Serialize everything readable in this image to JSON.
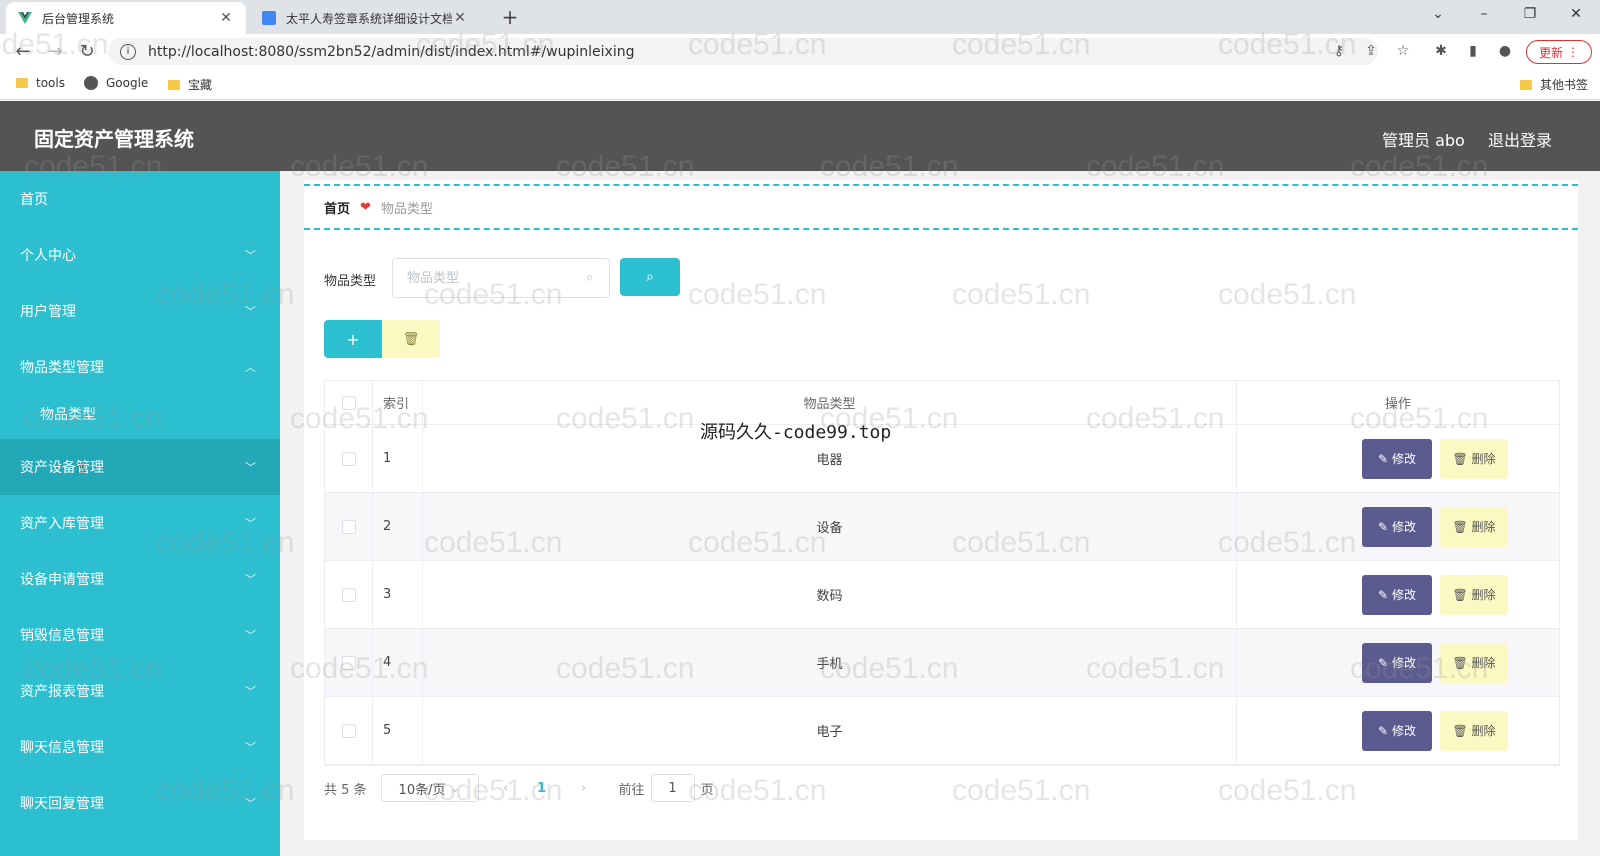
{
  "browser": {
    "tabs": [
      {
        "title": "后台管理系统",
        "active": true
      },
      {
        "title": "太平人寿签章系统详细设计文档",
        "active": false
      }
    ],
    "url": "http://localhost:8080/ssm2bn52/admin/dist/index.html#/wupinleixing",
    "update_label": "更新",
    "bookmarks": [
      "tools",
      "Google",
      "宝藏"
    ],
    "other_bookmarks": "其他书签"
  },
  "header": {
    "title": "固定资产管理系统",
    "user": "管理员 abo",
    "logout": "退出登录"
  },
  "sidebar": {
    "items": [
      {
        "label": "首页",
        "has_chevron": false
      },
      {
        "label": "个人中心",
        "has_chevron": true
      },
      {
        "label": "用户管理",
        "has_chevron": true
      },
      {
        "label": "物品类型管理",
        "has_chevron": true,
        "expanded": true
      },
      {
        "label": "物品类型",
        "sub": true
      },
      {
        "label": "资产设备管理",
        "has_chevron": true,
        "hover": true
      },
      {
        "label": "资产入库管理",
        "has_chevron": true
      },
      {
        "label": "设备申请管理",
        "has_chevron": true
      },
      {
        "label": "销毁信息管理",
        "has_chevron": true
      },
      {
        "label": "资产报表管理",
        "has_chevron": true
      },
      {
        "label": "聊天信息管理",
        "has_chevron": true
      },
      {
        "label": "聊天回复管理",
        "has_chevron": true
      }
    ]
  },
  "breadcrumb": {
    "home": "首页",
    "separator": "❤",
    "current": "物品类型"
  },
  "search": {
    "label": "物品类型",
    "placeholder": "物品类型"
  },
  "table": {
    "headers": {
      "index": "索引",
      "type": "物品类型",
      "ops": "操作"
    },
    "rows": [
      {
        "index": "1",
        "type": "电器"
      },
      {
        "index": "2",
        "type": "设备"
      },
      {
        "index": "3",
        "type": "数码"
      },
      {
        "index": "4",
        "type": "手机"
      },
      {
        "index": "5",
        "type": "电子"
      }
    ],
    "edit_label": "修改",
    "delete_label": "删除"
  },
  "pagination": {
    "total": "共 5 条",
    "page_size": "10条/页",
    "current_page": "1",
    "goto_label": "前往",
    "goto_value": "1",
    "page_suffix": "页"
  },
  "watermark": {
    "center_text": "源码久久-code99.top",
    "repeat_text": "code51.cn"
  },
  "colors": {
    "accent": "#2bbfcf",
    "header_bg": "#545454",
    "edit_btn": "#5b5b8f",
    "delete_btn": "#fcf8c2"
  }
}
